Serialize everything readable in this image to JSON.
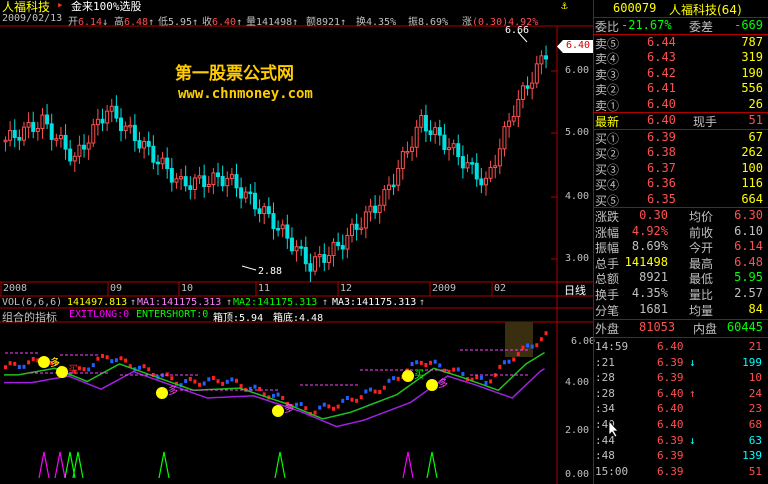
{
  "header": {
    "stock_name": "人福科技",
    "indicator_name": "金来100%选股",
    "date": "2009/02/13",
    "fields": [
      {
        "label": "开",
        "value": "6.14",
        "arrow": "↓",
        "color": "#ff5050"
      },
      {
        "label": "高",
        "value": "6.48",
        "arrow": "↑",
        "color": "#ff5050"
      },
      {
        "label": "低",
        "value": "5.95",
        "arrow": "↑",
        "color": "#c0c0c0"
      },
      {
        "label": "收",
        "value": "6.40",
        "arrow": "↑",
        "color": "#ff5050"
      },
      {
        "label": "量",
        "value": "141498",
        "arrow": "↑",
        "color": "#c0c0c0"
      },
      {
        "label": "额",
        "value": "8921",
        "arrow": "↑",
        "color": "#c0c0c0"
      },
      {
        "label": "换",
        "value": "4.35%",
        "arrow": "",
        "color": "#c0c0c0"
      },
      {
        "label": "振",
        "value": "8.69%",
        "arrow": "",
        "color": "#c0c0c0"
      },
      {
        "label": "涨",
        "value": "(0.30)4.92%",
        "arrow": "",
        "color": "#ff5050"
      }
    ]
  },
  "watermark": {
    "line1": "第一股票公式网",
    "line2": "www.chnmoney.com"
  },
  "main_chart": {
    "high_label": "6.66",
    "low_label": "2.88",
    "current_price_tag": "6.40",
    "y_ticks": [
      "6.00",
      "5.00",
      "4.00",
      "3.00"
    ],
    "x_labels": [
      "2008",
      "09",
      "10",
      "11",
      "12",
      "2009",
      "02"
    ],
    "period_button": "日线"
  },
  "vol_bar": {
    "label": "VOL(6,6,6)",
    "value": "141497.813",
    "ma1": "MA1:141175.313",
    "ma2": "MA2:141175.313",
    "ma3": "MA3:141175.313"
  },
  "indicator_bar": {
    "label": "组合的指标",
    "exitlong": "EXITLONG:0",
    "entershort": "ENTERSHORT:0",
    "box_top": "箱顶:5.94",
    "box_bottom": "箱底:4.48"
  },
  "lower_chart": {
    "y_ticks": [
      "6.00",
      "4.00",
      "2.00",
      "0.00"
    ],
    "buy_mark": "买",
    "sell_mark": "多"
  },
  "quote": {
    "code": "600079",
    "name": "人福科技(64)",
    "weibi_label": "委比",
    "weibi_value": "-21.67%",
    "weicha_label": "委差",
    "weicha_value": "-669",
    "sells": [
      {
        "label": "卖⑤",
        "price": "6.44",
        "vol": "787"
      },
      {
        "label": "卖④",
        "price": "6.43",
        "vol": "319"
      },
      {
        "label": "卖③",
        "price": "6.42",
        "vol": "190"
      },
      {
        "label": "卖②",
        "price": "6.41",
        "vol": "556"
      },
      {
        "label": "卖①",
        "price": "6.40",
        "vol": "26"
      }
    ],
    "latest_label": "最新",
    "latest_price": "6.40",
    "current_label": "现手",
    "current_vol": "51",
    "buys": [
      {
        "label": "买①",
        "price": "6.39",
        "vol": "67"
      },
      {
        "label": "买②",
        "price": "6.38",
        "vol": "262"
      },
      {
        "label": "买③",
        "price": "6.37",
        "vol": "100"
      },
      {
        "label": "买④",
        "price": "6.36",
        "vol": "116"
      },
      {
        "label": "买⑤",
        "price": "6.35",
        "vol": "664"
      }
    ],
    "stats": [
      {
        "l1": "涨跌",
        "v1": "0.30",
        "c1": "#ff5050",
        "l2": "均价",
        "v2": "6.30",
        "c2": "#ff5050"
      },
      {
        "l1": "涨幅",
        "v1": "4.92%",
        "c1": "#ff5050",
        "l2": "前收",
        "v2": "6.10",
        "c2": "#c0c0c0"
      },
      {
        "l1": "振幅",
        "v1": "8.69%",
        "c1": "#c0c0c0",
        "l2": "今开",
        "v2": "6.14",
        "c2": "#ff5050"
      },
      {
        "l1": "总手",
        "v1": "141498",
        "c1": "#ffff00",
        "l2": "最高",
        "v2": "6.48",
        "c2": "#ff5050"
      },
      {
        "l1": "总额",
        "v1": "8921",
        "c1": "#c0c0c0",
        "l2": "最低",
        "v2": "5.95",
        "c2": "#00ff00"
      },
      {
        "l1": "换手",
        "v1": "4.35%",
        "c1": "#c0c0c0",
        "l2": "量比",
        "v2": "2.57",
        "c2": "#c0c0c0"
      },
      {
        "l1": "分笔",
        "v1": "1681",
        "c1": "#c0c0c0",
        "l2": "均量",
        "v2": "84",
        "c2": "#ffff00"
      }
    ],
    "outer_label": "外盘",
    "outer_value": "81053",
    "inner_label": "内盘",
    "inner_value": "60445",
    "ticks": [
      {
        "time": "14:59",
        "price": "6.40",
        "arrow": "",
        "vol": "21",
        "pc": "#ff5050",
        "vc": "#ff5050"
      },
      {
        "time": ":21",
        "price": "6.39",
        "arrow": "↓",
        "vol": "199",
        "pc": "#ff5050",
        "vc": "#00ffff"
      },
      {
        "time": ":28",
        "price": "6.39",
        "arrow": "",
        "vol": "10",
        "pc": "#ff5050",
        "vc": "#ff5050"
      },
      {
        "time": ":28",
        "price": "6.40",
        "arrow": "↑",
        "vol": "24",
        "pc": "#ff5050",
        "vc": "#ff5050"
      },
      {
        "time": ":34",
        "price": "6.40",
        "arrow": "",
        "vol": "23",
        "pc": "#ff5050",
        "vc": "#ff5050"
      },
      {
        "time": ":40",
        "price": "6.40",
        "arrow": "",
        "vol": "68",
        "pc": "#ff5050",
        "vc": "#ff5050"
      },
      {
        "time": ":44",
        "price": "6.39",
        "arrow": "↓",
        "vol": "63",
        "pc": "#ff5050",
        "vc": "#00ffff"
      },
      {
        "time": ":48",
        "price": "6.39",
        "arrow": "",
        "vol": "139",
        "pc": "#ff5050",
        "vc": "#00ffff"
      },
      {
        "time": "15:00",
        "price": "6.39",
        "arrow": "",
        "vol": "51",
        "pc": "#ff5050",
        "vc": "#ff5050"
      }
    ]
  },
  "colors": {
    "up": "#ff5050",
    "down": "#00e0e0",
    "frame": "#b00000",
    "label_yellow": "#ffff00",
    "watermark": "#ffcc00"
  }
}
